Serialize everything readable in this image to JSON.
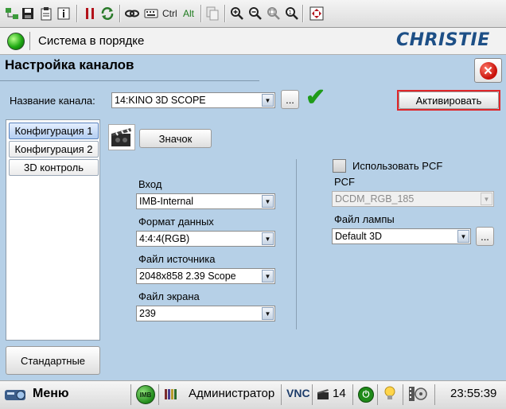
{
  "toolbar": {
    "ctrl_label": "Ctrl",
    "alt_label": "Alt"
  },
  "status": {
    "message": "Система в порядке",
    "brand": "CHRISTIE"
  },
  "panel": {
    "title": "Настройка каналов",
    "channel_label": "Название канала:",
    "channel_value": "14:KINO 3D SCOPE",
    "browse_label": "...",
    "activate_label": "Активировать"
  },
  "sidebar": {
    "items": [
      {
        "label": "Конфигурация 1",
        "active": true
      },
      {
        "label": "Конфигурация 2",
        "active": false
      },
      {
        "label": "3D контроль",
        "active": false
      }
    ],
    "defaults_label": "Стандартные"
  },
  "config": {
    "icon_button": "Значок",
    "input_label": "Вход",
    "input_value": "IMB-Internal",
    "format_label": "Формат данных",
    "format_value": "4:4:4(RGB)",
    "source_label": "Файл источника",
    "source_value": "2048x858 2.39 Scope",
    "screen_label": "Файл экрана",
    "screen_value": "239",
    "use_pcf_label": "Использовать PCF",
    "use_pcf_checked": false,
    "pcf_label": "PCF",
    "pcf_value": "DCDM_RGB_185",
    "lamp_label": "Файл лампы",
    "lamp_value": "Default 3D",
    "lamp_browse": "..."
  },
  "bottom": {
    "menu_label": "Меню",
    "imb_label": "IMB",
    "user": "Администратор",
    "vnc": "VNC",
    "channel_count": "14",
    "time": "23:55:39"
  },
  "colors": {
    "panel_bg": "#b6d0e7",
    "accent_blue": "#1d4f86",
    "status_ok": "#1faa13",
    "highlight_red": "#e0262a"
  }
}
